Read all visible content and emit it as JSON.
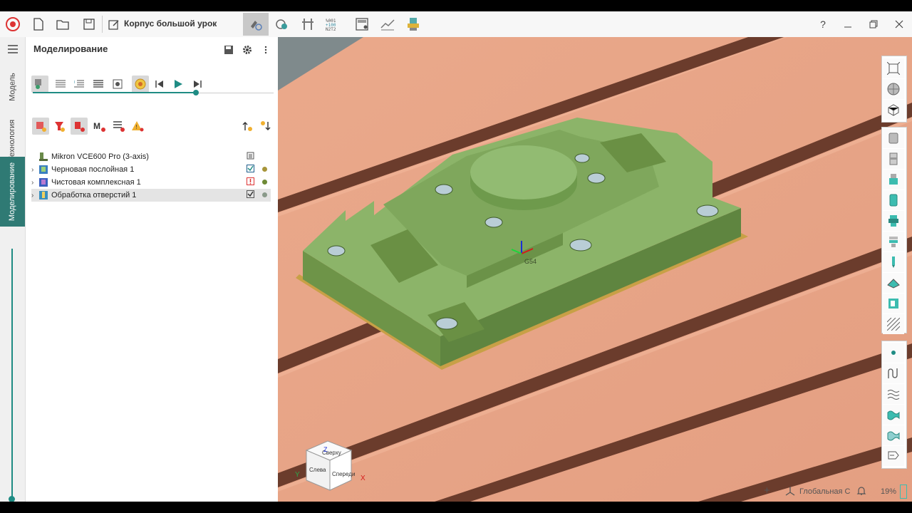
{
  "titlebar": {
    "document_title": "Корпус большой урок",
    "tools": [
      "simulation-tool",
      "verify-tool",
      "fixture-tool",
      "nc-code-tool",
      "calculator-tool",
      "measure-tool",
      "postprocess-tool"
    ],
    "nc_tool_label": "%001 +100 N2T2",
    "help_label": "?"
  },
  "vtabs": {
    "model": "Модель",
    "technology": "Технология",
    "simulation": "Моделирование"
  },
  "panel": {
    "title": "Моделирование",
    "timeline_progress": 0.68,
    "tree": [
      {
        "label": "Mikron VCE600 Pro (3-axis)",
        "status": "doc",
        "dot": ""
      },
      {
        "label": "Черновая послойная 1",
        "status": "ok",
        "dot": "#a7953a"
      },
      {
        "label": "Чистовая комплексная 1",
        "status": "warn",
        "dot": "#6e8a36"
      },
      {
        "label": "Обработка отверстий 1",
        "status": "ok",
        "dot": "#8a9a8a"
      }
    ]
  },
  "viewport": {
    "origin_label": "G54",
    "viewcube": {
      "top": "Сверху",
      "left": "Слева",
      "front": "Спереди"
    },
    "axis_x": "X",
    "axis_y": "Y",
    "axis_z": "Z",
    "status_plus": "+",
    "coordinate_system": "Глобальная С",
    "zoom": "19%"
  },
  "colors": {
    "accent": "#1f8c84",
    "part_green": "#7aa55a",
    "table_copper": "#e8a587",
    "slot_brown": "#6b3c2c"
  }
}
